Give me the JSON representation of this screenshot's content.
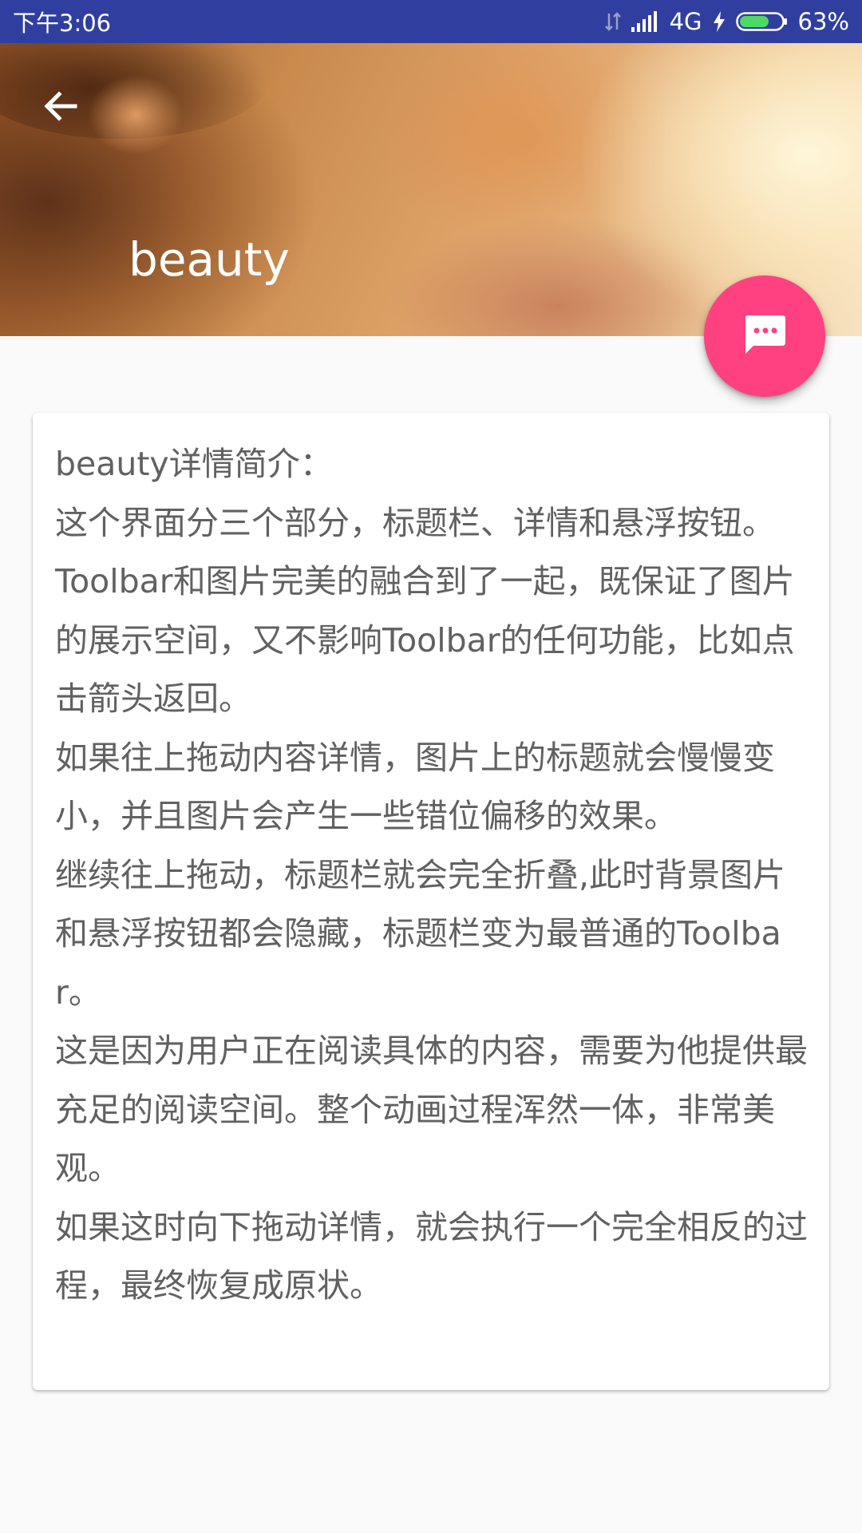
{
  "status_bar": {
    "time": "下午3:06",
    "network": "4G",
    "battery": "63%",
    "icons": [
      "data-transfer-icon",
      "signal-icon",
      "charging-icon",
      "battery-icon"
    ],
    "background_color": "#303f9f"
  },
  "toolbar": {
    "back_icon": "arrow-back-icon",
    "title": "beauty"
  },
  "fab": {
    "icon": "chat-message-icon",
    "color": "#ff4081"
  },
  "detail": {
    "paragraphs": [
      "beauty详情简介：",
      "这个界面分三个部分，标题栏、详情和悬浮按钮。",
      "Toolbar和图片完美的融合到了一起，既保证了图片的展示空间，又不影响Toolbar的任何功能，比如点击箭头返回。",
      "如果往上拖动内容详情，图片上的标题就会慢慢变小，并且图片会产生一些错位偏移的效果。",
      "继续往上拖动，标题栏就会完全折叠,此时背景图片和悬浮按钮都会隐藏，标题栏变为最普通的Toolbar。",
      "这是因为用户正在阅读具体的内容，需要为他提供最充足的阅读空间。整个动画过程浑然一体，非常美观。",
      "如果这时向下拖动详情，就会执行一个完全相反的过程，最终恢复成原状。"
    ]
  }
}
